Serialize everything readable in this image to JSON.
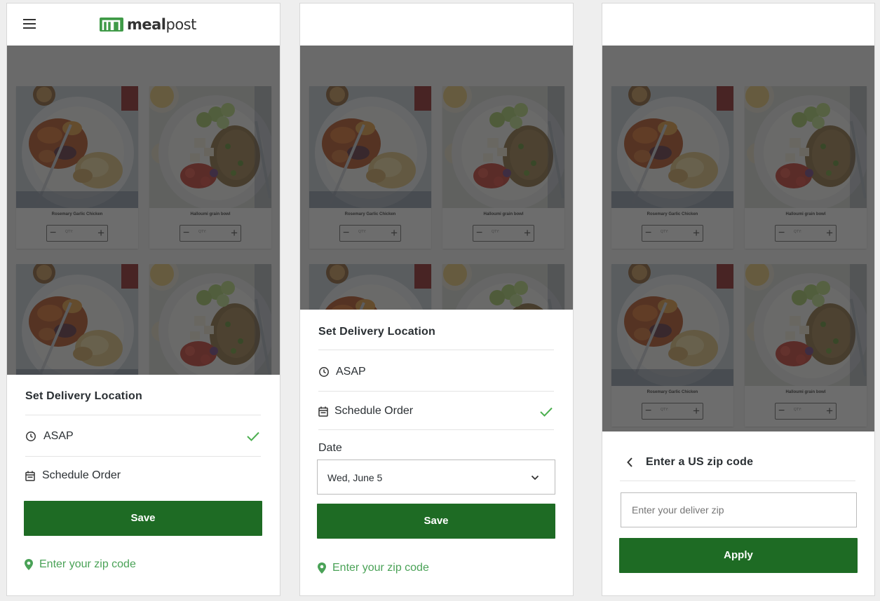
{
  "app": {
    "logo_text_bold": "meal",
    "logo_text_light": "post"
  },
  "meals": [
    {
      "name": "Rosemary Garlic Chicken",
      "qty_label": "QTY:"
    },
    {
      "name": "Halloumi grain bowl",
      "qty_label": "QTY:"
    }
  ],
  "stepper": {
    "minus": "−",
    "plus": "+"
  },
  "screen1": {
    "sheet_title": "Set Delivery Location",
    "option_asap": "ASAP",
    "option_schedule": "Schedule Order",
    "save_label": "Save",
    "zip_link": "Enter your zip code"
  },
  "screen2": {
    "sheet_title": "Set Delivery Location",
    "option_asap": "ASAP",
    "option_schedule": "Schedule Order",
    "date_label": "Date",
    "date_value": "Wed, June 5",
    "save_label": "Save",
    "zip_link": "Enter your zip code"
  },
  "screen3": {
    "sheet_title": "Enter a US zip code",
    "zip_placeholder": "Enter your deliver zip",
    "apply_label": "Apply"
  },
  "colors": {
    "primary_green": "#1e6b24",
    "accent_green": "#4aa257",
    "check_green": "#4caf50",
    "overlay": "#282828"
  },
  "icons": [
    "menu-icon",
    "clock-icon",
    "calendar-icon",
    "check-icon",
    "location-pin-icon",
    "chevron-down-icon",
    "chevron-left-icon"
  ]
}
